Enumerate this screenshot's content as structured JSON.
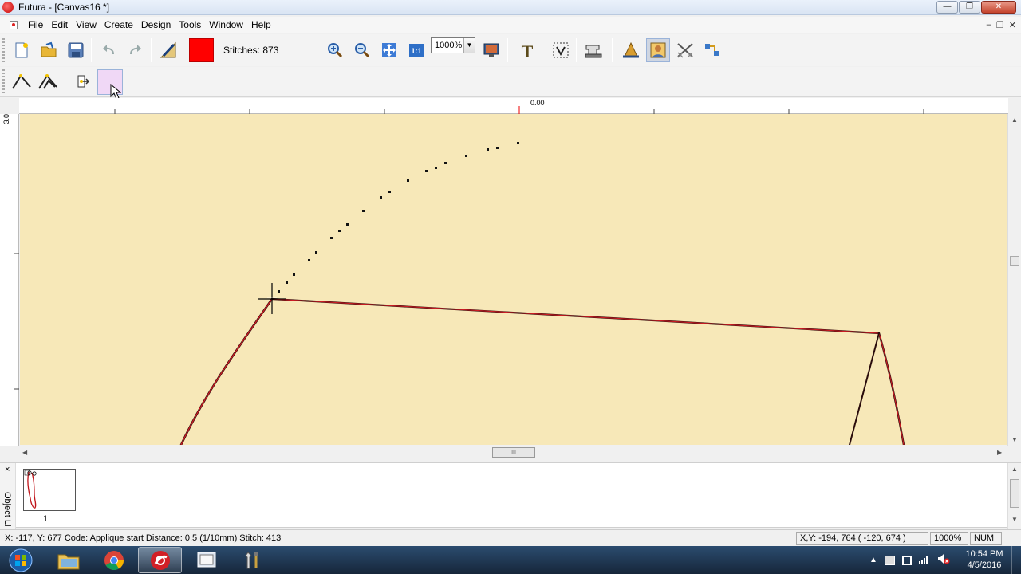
{
  "window": {
    "title": "Futura - [Canvas16 *]",
    "controls": {
      "minimize": "—",
      "maximize": "❐",
      "close": "✕"
    },
    "mdi_controls": {
      "minimize": "–",
      "restore": "❐",
      "close": "✕"
    }
  },
  "menu": {
    "items": [
      {
        "pre": "",
        "ul": "F",
        "post": "ile"
      },
      {
        "pre": "",
        "ul": "E",
        "post": "dit"
      },
      {
        "pre": "",
        "ul": "V",
        "post": "iew"
      },
      {
        "pre": "",
        "ul": "C",
        "post": "reate"
      },
      {
        "pre": "",
        "ul": "D",
        "post": "esign"
      },
      {
        "pre": "",
        "ul": "T",
        "post": "ools"
      },
      {
        "pre": "",
        "ul": "W",
        "post": "indow"
      },
      {
        "pre": "",
        "ul": "H",
        "post": "elp"
      }
    ]
  },
  "toolbar": {
    "stitches_label": "Stitches: 873",
    "zoom_value": "1000%",
    "color": "#ff0000",
    "text_tool_glyph": "T"
  },
  "canvas": {
    "ruler_origin_label": "0.00",
    "vertical_ruler_label": "3.0",
    "background": "#f7e8b8",
    "outline_color": "#c0141a",
    "scroll_thumb_glyph": "III"
  },
  "object_list": {
    "close_glyph": "×",
    "panel_label": "Object Li",
    "thumbnail_number": "1"
  },
  "status": {
    "left": "X: -117, Y: 677   Code: Applique start  Distance: 0.5 (1/10mm)  Stitch: 413",
    "xy": "X,Y: -194, 764  ( -120, 674 )",
    "zoom": "1000%",
    "num": "NUM"
  },
  "taskbar": {
    "time": "10:54 PM",
    "date": "4/5/2016"
  }
}
